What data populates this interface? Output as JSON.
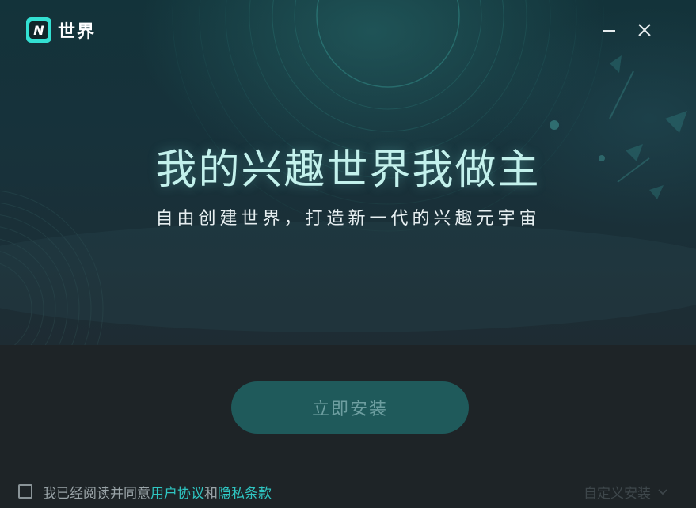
{
  "app": {
    "logo_letter": "N",
    "logo_name": "世界",
    "accent_color": "#33e0d2"
  },
  "window_controls": {
    "minimize_icon": "minimize-icon",
    "close_icon": "close-icon"
  },
  "hero": {
    "headline": "我的兴趣世界我做主",
    "subline": "自由创建世界，打造新一代的兴趣元宇宙"
  },
  "install": {
    "button_label": "立即安装",
    "button_color": "#1f5a5b"
  },
  "agreement": {
    "checked": false,
    "prefix": "我已经阅读并同意",
    "user_agreement": "用户协议",
    "conjunction": "和",
    "privacy_terms": "隐私条款",
    "link_color": "#2fc6c2"
  },
  "custom_install": {
    "label": "自定义安装",
    "icon": "chevron-down-icon"
  }
}
